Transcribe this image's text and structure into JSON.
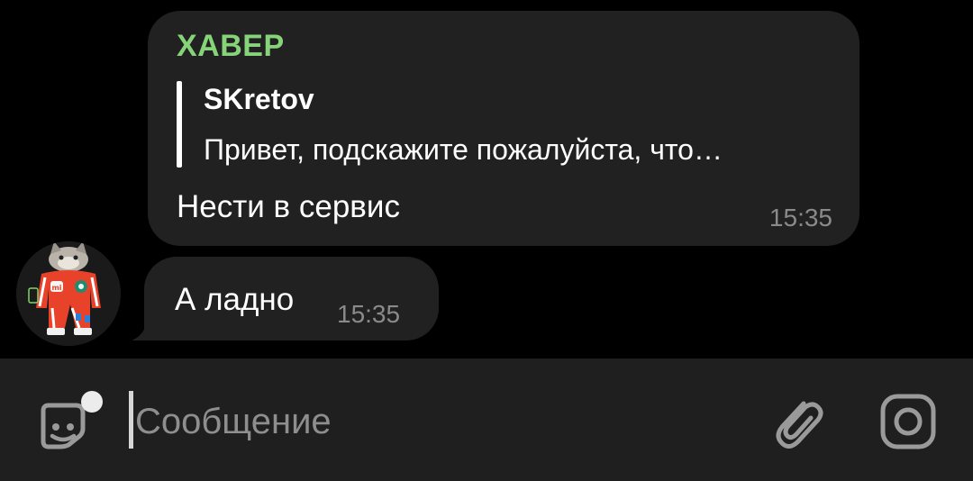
{
  "messages": [
    {
      "sender": "ХАВЕР",
      "reply": {
        "author": "SKretov",
        "text": "Привет, подскажите пожалуйста, что…"
      },
      "text": "Нести в сервис",
      "time": "15:35"
    },
    {
      "text": "А ладно",
      "time": "15:35"
    }
  ],
  "composer": {
    "placeholder": "Сообщение"
  },
  "colors": {
    "sender_name": "#86d37a",
    "bubble": "#212121",
    "background": "#000000",
    "input_bar": "#1f1f1f",
    "time": "#8a8a8a",
    "avatar_suit": "#e8432a"
  },
  "icons": {
    "sticker": "sticker-emoji-icon",
    "attach": "paperclip-icon",
    "camera": "camera-icon",
    "avatar_logo": "mi-logo-icon"
  },
  "avatar_text": "mi"
}
